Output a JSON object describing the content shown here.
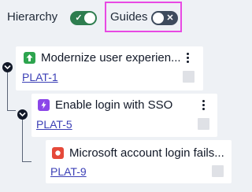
{
  "toolbar": {
    "hierarchy_label": "Hierarchy",
    "hierarchy_on": true,
    "guides_label": "Guides",
    "guides_on": false
  },
  "colors": {
    "toggle_on": "#2e7d4f",
    "toggle_off": "#3d4a5c",
    "highlight": "#e849e3",
    "story": "#2da44e",
    "feature": "#8b46e8",
    "bug": "#e5493a",
    "link": "#3b3fb6"
  },
  "issues": [
    {
      "title": "Modernize user experien...",
      "key": "PLAT-1",
      "type_icon": "arrow-up-icon",
      "level": 0
    },
    {
      "title": "Enable login with SSO",
      "key": "PLAT-5",
      "type_icon": "lightning-icon",
      "level": 1
    },
    {
      "title": "Microsoft account login fails...",
      "key": "PLAT-9",
      "type_icon": "stop-icon",
      "level": 2
    }
  ]
}
